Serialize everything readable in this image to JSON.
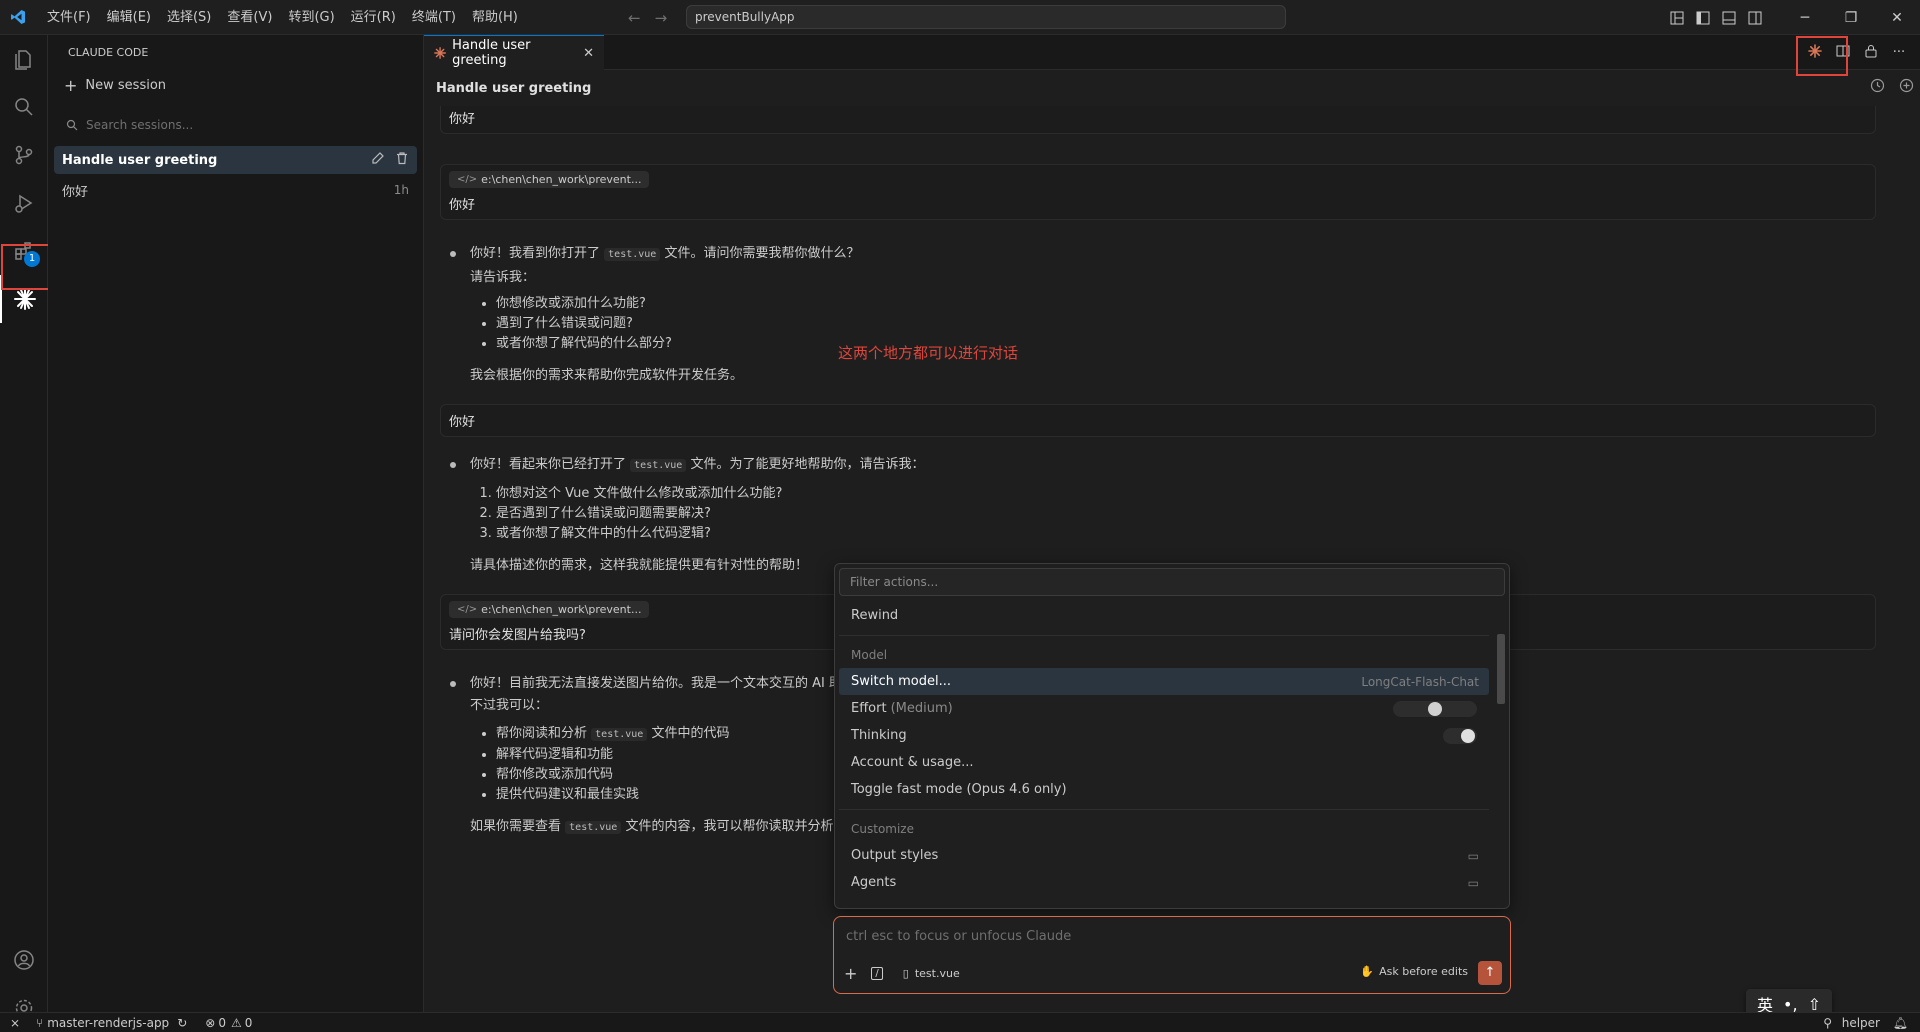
{
  "titlebar": {
    "menu": [
      "文件(F)",
      "编辑(E)",
      "选择(S)",
      "查看(V)",
      "转到(G)",
      "运行(R)",
      "终端(T)",
      "帮助(H)"
    ],
    "search_text": "preventBullyApp"
  },
  "activity": {
    "extensions_badge": "1"
  },
  "sidebar": {
    "title": "CLAUDE CODE",
    "new_session": "New session",
    "search_placeholder": "Search sessions...",
    "session_title": "Handle user greeting",
    "session_preview": "你好",
    "session_time": "1h"
  },
  "editor": {
    "tab_label": "Handle user greeting",
    "panel_title": "Handle user greeting"
  },
  "chat": {
    "msg1": "你好",
    "file_chip": "e:\\chen\\chen_work\\prevent...",
    "msg2": "你好",
    "a1_lead_pre": "你好！我看到你打开了",
    "a1_code": "test.vue",
    "a1_lead_post": "文件。请问你需要我帮你做什么？",
    "a1_tell": "请告诉我：",
    "a1_items": [
      "你想修改或添加什么功能?",
      "遇到了什么错误或问题?",
      "或者你想了解代码的什么部分?"
    ],
    "a1_close": "我会根据你的需求来帮助你完成软件开发任务。",
    "msg3": "你好",
    "a2_lead_pre": "你好！看起来你已经打开了",
    "a2_code": "test.vue",
    "a2_lead_post": "文件。为了能更好地帮助你，请告诉我：",
    "a2_items": [
      "你想对这个 Vue 文件做什么修改或添加什么功能?",
      "是否遇到了什么错误或问题需要解决?",
      "或者你想了解文件中的什么代码逻辑?"
    ],
    "a2_close": "请具体描述你的需求，这样我就能提供更有针对性的帮助！",
    "file_chip2": "e:\\chen\\chen_work\\prevent...",
    "msg4": "请问你会发图片给我吗?",
    "a3_lead": "你好！目前我无法直接发送图片给你。我是一个文本交互的 AI 助",
    "a3_sub": "不过我可以：",
    "a3_items_pre": "帮你阅读和分析",
    "a3_items_code": "test.vue",
    "a3_items_post": "文件中的代码",
    "a3_items": [
      "解释代码逻辑和功能",
      "帮你修改或添加代码",
      "提供代码建议和最佳实践"
    ],
    "a3_close_pre": "如果你需要查看",
    "a3_close_code": "test.vue",
    "a3_close_post": "文件的内容，我可以帮你读取并分析"
  },
  "annotation": "这两个地方都可以进行对话",
  "popup": {
    "filter_placeholder": "Filter actions...",
    "rewind": "Rewind",
    "cat_model": "Model",
    "switch_model": "Switch model...",
    "switch_model_value": "LongCat-Flash-Chat",
    "effort": "Effort",
    "effort_hint": "(Medium)",
    "effort_level": 0.5,
    "thinking": "Thinking",
    "thinking_on": true,
    "account": "Account & usage...",
    "fast_mode": "Toggle fast mode (Opus 4.6 only)",
    "cat_customize": "Customize",
    "output_styles": "Output styles",
    "agents": "Agents"
  },
  "input": {
    "placeholder": "ctrl esc to focus or unfocus Claude",
    "file": "test.vue",
    "mode": "Ask before edits"
  },
  "statusbar": {
    "branch": "master-renderjs-app",
    "errors": "0",
    "warnings": "0",
    "helper": "helper"
  },
  "ime": {
    "lang": "英"
  }
}
